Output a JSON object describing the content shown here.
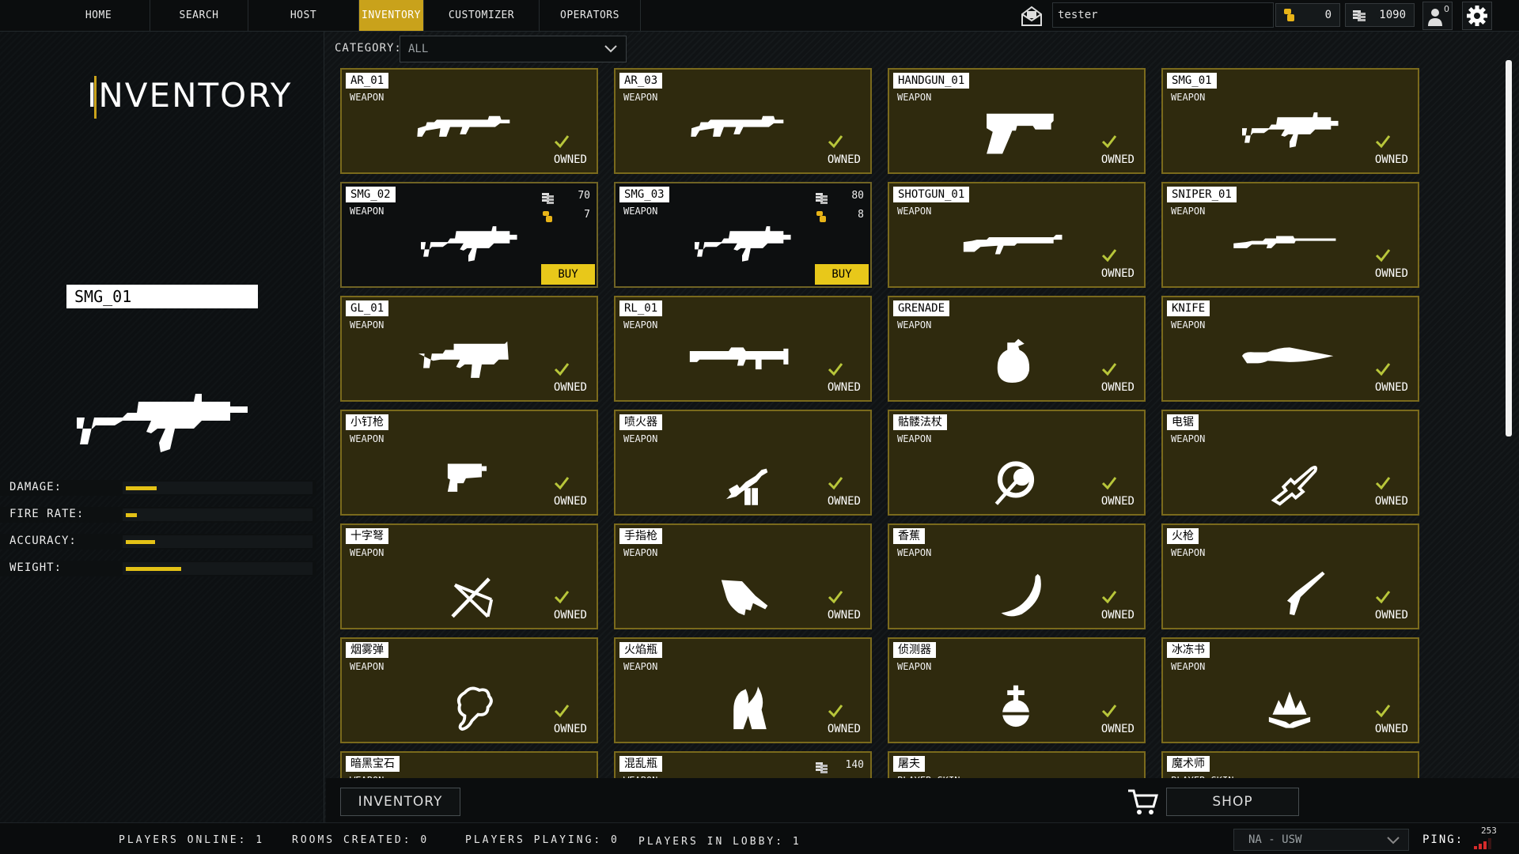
{
  "nav": {
    "tabs": [
      {
        "label": "HOME"
      },
      {
        "label": "SEARCH"
      },
      {
        "label": "HOST"
      },
      {
        "label": "INVENTORY",
        "active": true
      },
      {
        "label": "CUSTOMIZER"
      },
      {
        "label": "OPERATORS"
      }
    ],
    "username": "tester",
    "gold": "0",
    "coins": "1090",
    "friend_requests": "0"
  },
  "left": {
    "title": "INVENTORY",
    "selected_item": "SMG_01",
    "stats": [
      {
        "label": "DAMAGE:",
        "level": 0.17
      },
      {
        "label": "FIRE RATE:",
        "level": 0.06
      },
      {
        "label": "ACCURACY:",
        "level": 0.16
      },
      {
        "label": "WEIGHT:",
        "level": 0.3
      }
    ]
  },
  "category": {
    "label": "CATEGORY:",
    "value": "ALL"
  },
  "items": [
    {
      "name": "AR_01",
      "type": "WEAPON",
      "status": "OWNED",
      "icon": "rifle-icon"
    },
    {
      "name": "AR_03",
      "type": "WEAPON",
      "status": "OWNED",
      "icon": "rifle-icon"
    },
    {
      "name": "HANDGUN_01",
      "type": "WEAPON",
      "status": "OWNED",
      "icon": "pistol-icon"
    },
    {
      "name": "SMG_01",
      "type": "WEAPON",
      "status": "OWNED",
      "icon": "smg-icon"
    },
    {
      "name": "SMG_02",
      "type": "WEAPON",
      "buy_label": "BUY",
      "coin_price": "70",
      "gold_price": "7",
      "icon": "smg-icon"
    },
    {
      "name": "SMG_03",
      "type": "WEAPON",
      "buy_label": "BUY",
      "coin_price": "80",
      "gold_price": "8",
      "icon": "smg-icon"
    },
    {
      "name": "SHOTGUN_01",
      "type": "WEAPON",
      "status": "OWNED",
      "icon": "shotgun-icon"
    },
    {
      "name": "SNIPER_01",
      "type": "WEAPON",
      "status": "OWNED",
      "icon": "sniper-icon"
    },
    {
      "name": "GL_01",
      "type": "WEAPON",
      "status": "OWNED",
      "icon": "grenade-launcher-icon"
    },
    {
      "name": "RL_01",
      "type": "WEAPON",
      "status": "OWNED",
      "icon": "rocket-launcher-icon"
    },
    {
      "name": "GRENADE",
      "type": "WEAPON",
      "status": "OWNED",
      "icon": "grenade-icon"
    },
    {
      "name": "KNIFE",
      "type": "WEAPON",
      "status": "OWNED",
      "icon": "knife-icon"
    },
    {
      "name": "小钉枪",
      "type": "WEAPON",
      "status": "OWNED",
      "icon": "nail-gun-icon"
    },
    {
      "name": "喷火器",
      "type": "WEAPON",
      "status": "OWNED",
      "icon": "flamethrower-icon"
    },
    {
      "name": "骷髅法杖",
      "type": "WEAPON",
      "status": "OWNED",
      "icon": "skull-staff-icon"
    },
    {
      "name": "电锯",
      "type": "WEAPON",
      "status": "OWNED",
      "icon": "chainsaw-icon"
    },
    {
      "name": "十字弩",
      "type": "WEAPON",
      "status": "OWNED",
      "icon": "crossbow-icon"
    },
    {
      "name": "手指枪",
      "type": "WEAPON",
      "status": "OWNED",
      "icon": "finger-gun-icon"
    },
    {
      "name": "香蕉",
      "type": "WEAPON",
      "status": "OWNED",
      "icon": "banana-icon"
    },
    {
      "name": "火枪",
      "type": "WEAPON",
      "status": "OWNED",
      "icon": "musket-icon"
    },
    {
      "name": "烟雾弹",
      "type": "WEAPON",
      "status": "OWNED",
      "icon": "smoke-bomb-icon"
    },
    {
      "name": "火焰瓶",
      "type": "WEAPON",
      "status": "OWNED",
      "icon": "molotov-icon"
    },
    {
      "name": "侦测器",
      "type": "WEAPON",
      "status": "OWNED",
      "icon": "orb-icon"
    },
    {
      "name": "冰冻书",
      "type": "WEAPON",
      "status": "OWNED",
      "icon": "spellbook-icon"
    },
    {
      "name": "暗黑宝石",
      "type": "WEAPON",
      "icon": "gem-icon"
    },
    {
      "name": "混乱瓶",
      "type": "WEAPON",
      "coin_price": "140",
      "icon": "bottle-icon"
    },
    {
      "name": "屠夫",
      "type": "PLAYER SKIN",
      "icon": "skin-icon"
    },
    {
      "name": "魔术师",
      "type": "PLAYER SKIN",
      "icon": "skin-icon"
    }
  ],
  "bottom": {
    "inventory_button": "INVENTORY",
    "shop_button": "SHOP"
  },
  "footer": {
    "players_online": "PLAYERS ONLINE: 1",
    "rooms_created": "ROOMS CREATED: 0",
    "players_playing": "PLAYERS PLAYING: 0",
    "players_in_lobby": "PLAYERS IN LOBBY: 1",
    "region": "NA - USW",
    "ping_label": "PING:",
    "ping_value": "253"
  },
  "colors": {
    "accent": "#c9a21b",
    "owned_card": "#2f2a0e",
    "buy_button": "#e8c81a",
    "stat_bar": "#e4c216"
  }
}
